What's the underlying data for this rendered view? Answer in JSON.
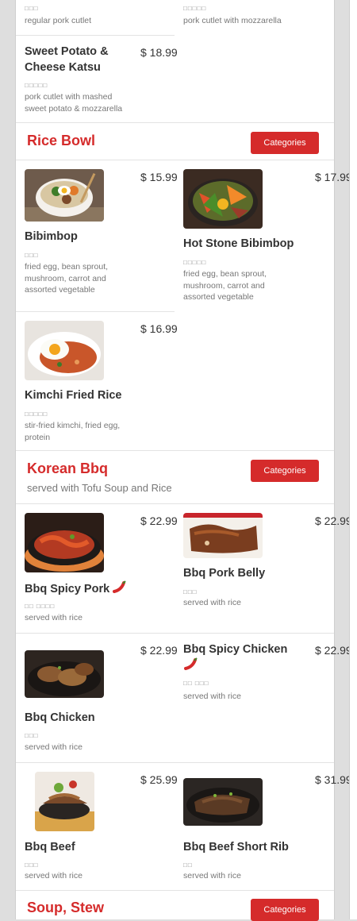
{
  "pork_katsu": {
    "item_a": {
      "kor": "□□□",
      "desc": "regular pork cutlet"
    },
    "item_b": {
      "kor": "□□□□□",
      "desc": "pork cutlet with mozzarella"
    },
    "item_c": {
      "name": "Sweet Potato & Cheese Katsu",
      "price": "$ 18.99",
      "kor": "□□□□□",
      "desc": "pork cutlet with mashed sweet potato & mozzarella"
    }
  },
  "rice_bowl": {
    "title": "Rice Bowl",
    "button": "Categories",
    "items": [
      {
        "name": "Bibimbop",
        "price": "$ 15.99",
        "kor": "□□□",
        "desc": "fried egg, bean sprout, mushroom, carrot and assorted vegetable"
      },
      {
        "name": "Hot Stone Bibimbop",
        "price": "$ 17.99",
        "kor": "□□□□□",
        "desc": "fried egg, bean sprout, mushroom, carrot and assorted vegetable"
      },
      {
        "name": "Kimchi Fried Rice",
        "price": "$ 16.99",
        "kor": "□□□□□",
        "desc": "stir-fried kimchi, fried egg, protein"
      }
    ]
  },
  "korean_bbq": {
    "title": "Korean Bbq",
    "subtitle": "served with Tofu Soup and Rice",
    "button": "Categories",
    "items": [
      {
        "name": "Bbq Spicy Pork",
        "price": "$ 22.99",
        "kor": "□□ □□□□",
        "desc": "served with rice",
        "spicy": true
      },
      {
        "name": "Bbq Pork Belly",
        "price": "$ 22.99",
        "kor": "□□□",
        "desc": "served with rice"
      },
      {
        "name": "Bbq Chicken",
        "price": "$ 22.99",
        "kor": "□□□",
        "desc": "served with rice"
      },
      {
        "name": "Bbq Spicy Chicken",
        "price": "$ 22.99",
        "kor": "□□ □□□",
        "desc": "served with rice",
        "spicy": true
      },
      {
        "name": "Bbq Beef",
        "price": "$ 25.99",
        "kor": "□□□",
        "desc": "served with rice"
      },
      {
        "name": "Bbq Beef Short Rib",
        "price": "$ 31.99",
        "kor": "□□",
        "desc": "served with rice"
      }
    ]
  },
  "soup_stew": {
    "title": "Soup, Stew",
    "button": "Categories"
  },
  "colors": {
    "accent": "#d52b2b",
    "text": "#333333",
    "muted": "#777777",
    "divider": "#e3e3e3"
  }
}
